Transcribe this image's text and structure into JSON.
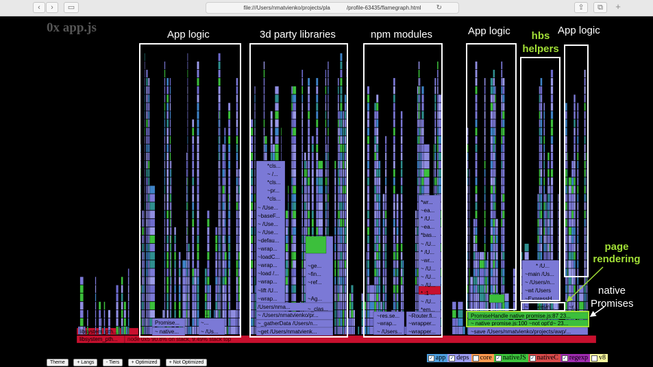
{
  "browser": {
    "url": "file:///Users/nmatvienko/projects/pla   /profile-63435/flamegraph.html",
    "back_glyph": "‹",
    "forward_glyph": "›",
    "sidebar_glyph": "▭",
    "share_glyph": "⇪",
    "tabs_glyph": "⧉",
    "add_glyph": "+",
    "reload_glyph": "↻"
  },
  "app_title": "0x app.js",
  "annotations": {
    "app_logic_1": "App logic",
    "third_party": "3d party libraries",
    "npm_modules": "npm modules",
    "app_logic_2": "App logic",
    "hbs_helpers": "hbs helpers",
    "app_logic_3": "App logic",
    "page_rendering": "page rendering",
    "native_promises": "native Promises"
  },
  "frame_labels": {
    "root_a": "libsystem_pth...",
    "root_b": "libsystem_pth...",
    "root_node": "node  0x5  90.8% on stack, 9.49% stack top",
    "app1": [
      "Promise...",
      "~ native...",
      "~ /Us...",
      "~...",
      "~..."
    ],
    "third": [
      "*cls...",
      "~ /...",
      "*cls...",
      "~pr...",
      "*cls...",
      "~ /Use...",
      "~baseF...",
      "~ /Use...",
      "~ /Use...",
      "~defau...",
      "~wrap...",
      "~loadC...",
      "~wrap...",
      "~load /...",
      "~wrap...",
      "~lift /U...",
      "~wrap...",
      "/Users/nma...",
      "~ /Users/nmatvienko/pr...",
      "~_gatherData /Users/n...",
      "~get /Users/nmatvienk...",
      "~ge...",
      "~fin...",
      "~ref...",
      "~Ag...",
      "~_clas..."
    ],
    "npm": [
      "*wr...",
      "~ea...",
      "* /U...",
      "~ea...",
      "*bas...",
      "~ /U...",
      "* /U...",
      "~wr...",
      "~ /U...",
      "~ /U...",
      "~ /U...",
      "* :1 ...",
      "~ /U...",
      "*em...",
      "~wrap...",
      "~res.se...",
      "~ /Users...",
      "~Router.fi...",
      "~wrapper...",
      "~wrapper..."
    ],
    "hbs": [
      "* /U...",
      "~main /Us...",
      "~ /Users/n...",
      "~wt /Users",
      "~ExpressH...",
      "~ /Users/n...",
      "~r..."
    ],
    "promise_handle": "PromiseHandle native promise.js:87 23...",
    "native_promise": "~ native promise.js:100 ~not opt'd~ 23...",
    "save": "~save /Users/nmatvienko/projects/awp/..."
  },
  "controls": [
    "Theme",
    "+ Langs",
    "- Tiers",
    "+ Optimized",
    "+ Not Optimized"
  ],
  "legend": [
    {
      "label": "app",
      "checked": true,
      "color": "#4d9fe0"
    },
    {
      "label": "deps",
      "checked": true,
      "color": "#9c9cf2"
    },
    {
      "label": "core",
      "checked": false,
      "color": "#ff9b4f"
    },
    {
      "label": "nativeJS",
      "checked": true,
      "color": "#3cc43c"
    },
    {
      "label": "nativeC",
      "checked": true,
      "color": "#d94a4a"
    },
    {
      "label": "regexp",
      "checked": true,
      "color": "#a02bb0"
    },
    {
      "label": "v8",
      "checked": false,
      "color": "#f7f79c"
    }
  ],
  "colors": {
    "frame_purple": "#7b79d6",
    "frame_blue": "#3f84c8",
    "frame_teal": "#2f8f8f",
    "frame_green": "#3cbf3c",
    "frame_red": "#c8102e",
    "annotation_green": "#a2df37"
  }
}
